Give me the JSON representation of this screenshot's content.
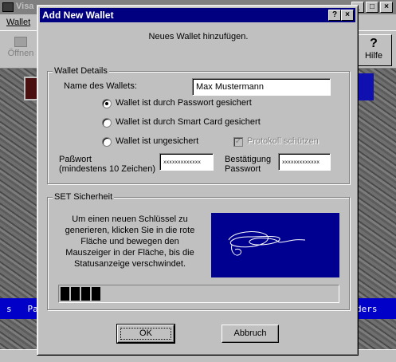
{
  "background_app": {
    "title": "Visa",
    "menu": {
      "wallet": "Wallet"
    },
    "toolbar": {
      "open_label": "Öffnen",
      "help_label": "Hilfe"
    },
    "ticker": {
      "left_text": "s   Pa",
      "right_text": "ders"
    }
  },
  "dialog": {
    "title": "Add New Wallet",
    "help_button": "?",
    "close_button": "×",
    "subtitle": "Neues Wallet hinzufügen.",
    "wallet_details": {
      "group_label": "Wallet Details",
      "name_label": "Name des Wallets:",
      "name_value": "Max Mustermann",
      "radio_password": "Wallet ist durch Passwort gesichert",
      "radio_smartcard": "Wallet ist durch Smart Card gesichert",
      "radio_unsecured": "Wallet ist ungesichert",
      "selected_option": "password",
      "protocol_checkbox": "Protokoll schützen",
      "protocol_checked": true,
      "password_label_line1": "Paßwort",
      "password_label_line2": "(mindestens 10 Zeichen)",
      "password_value": "xxxxxxxxxxxxx",
      "confirm_label_line1": "Bestätigung",
      "confirm_label_line2": "Passwort",
      "confirm_value": "xxxxxxxxxxxxx"
    },
    "set_security": {
      "group_label": "SET Sicherheit",
      "instructions": "Um einen neuen Schlüssel zu generieren, klicken Sie in die rote Fläche und bewegen den Mauszeiger in der Fläche, bis die Statusanzeige verschwindet.",
      "random_area_color": "#000090",
      "progress_blocks_filled": 4,
      "progress_fraction": 0.15
    },
    "ok_label": "OK",
    "cancel_label": "Abbruch"
  }
}
